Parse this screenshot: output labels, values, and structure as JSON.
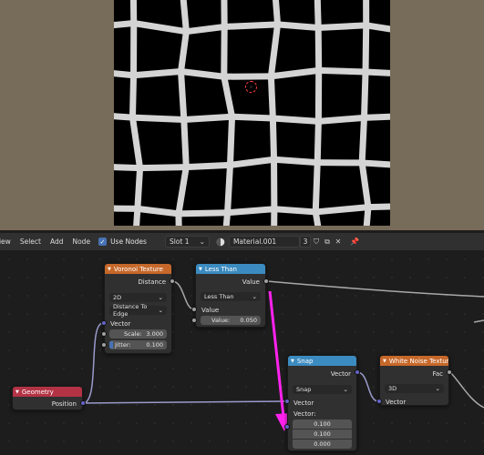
{
  "header": {
    "menus": [
      "View",
      "Select",
      "Add",
      "Node"
    ],
    "use_nodes_label": "Use Nodes",
    "slot_value": "Slot 1",
    "material_name": "Material.001",
    "user_count": "3"
  },
  "nodes": {
    "voronoi": {
      "title": "Voronoi Texture",
      "output_distance": "Distance",
      "dimension": "2D",
      "feature": "Distance To Edge",
      "input_vector": "Vector",
      "scale_label": "Scale:",
      "scale_value": "3.000",
      "jitter_label": "Jitter:",
      "jitter_value": "0.100"
    },
    "less_than": {
      "title": "Less Than",
      "output_value": "Value",
      "operation": "Less Than",
      "input_value": "Value",
      "threshold_label": "Value:",
      "threshold_value": "0.050"
    },
    "geometry": {
      "title": "Geometry",
      "output_position": "Position"
    },
    "snap": {
      "title": "Snap",
      "output_vector": "Vector",
      "operation": "Snap",
      "input_vector": "Vector",
      "increment_label": "Vector:",
      "x": "0.100",
      "y": "0.100",
      "z": "0.000"
    },
    "white_noise": {
      "title": "White Noise Textur",
      "output_fac": "Fac",
      "dimension": "3D",
      "input_vector": "Vector"
    }
  },
  "colors": {
    "annotation_arrow": "#ff22ee",
    "texture_header": "#c6682a",
    "converter_header": "#3b8bc0",
    "input_header": "#b33345",
    "vector_socket": "#6363c7"
  }
}
